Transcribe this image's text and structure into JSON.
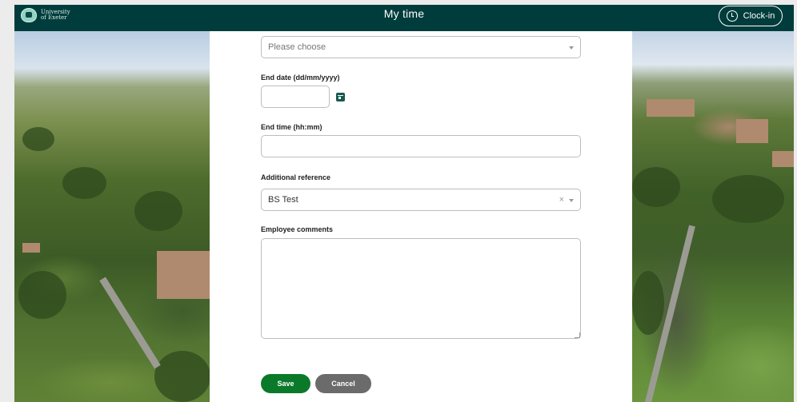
{
  "header": {
    "brand_line1": "University",
    "brand_line2": "of Exeter",
    "title": "My time",
    "clockin_label": "Clock-in",
    "clockin_icon": "clock-icon"
  },
  "form": {
    "first_select": {
      "placeholder": "Please choose"
    },
    "end_date": {
      "label": "End date (dd/mm/yyyy)",
      "value": "",
      "icon": "calendar-icon"
    },
    "end_time": {
      "label": "End time (hh:mm)",
      "value": ""
    },
    "additional_reference": {
      "label": "Additional reference",
      "value": "BS Test"
    },
    "employee_comments": {
      "label": "Employee comments",
      "value": ""
    },
    "save_label": "Save",
    "cancel_label": "Cancel"
  },
  "colors": {
    "header_bg": "#003c3c",
    "save_bg": "#0a7a2a",
    "cancel_bg": "#6b6b6b",
    "calendar_icon": "#155a4f"
  }
}
